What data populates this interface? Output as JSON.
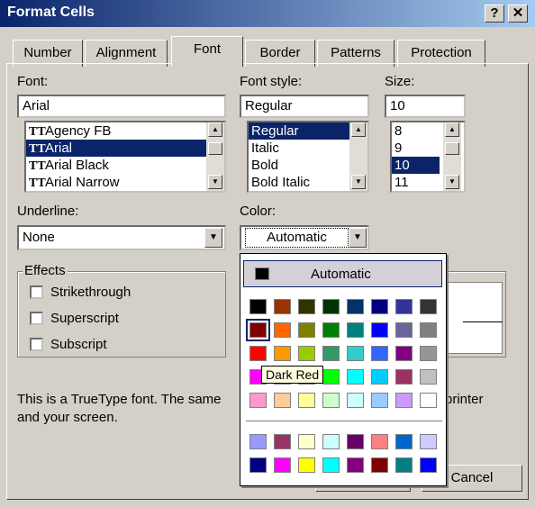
{
  "window": {
    "title": "Format Cells",
    "help_glyph": "?",
    "close_glyph": "✕"
  },
  "tabs": [
    {
      "label": "Number"
    },
    {
      "label": "Alignment"
    },
    {
      "label": "Font",
      "active": true
    },
    {
      "label": "Border"
    },
    {
      "label": "Patterns"
    },
    {
      "label": "Protection"
    }
  ],
  "font": {
    "label": "Font:",
    "value": "Arial",
    "items": [
      {
        "label": "Agency FB"
      },
      {
        "label": "Arial",
        "selected": true
      },
      {
        "label": "Arial Black"
      },
      {
        "label": "Arial Narrow"
      }
    ],
    "type_icon": "TT"
  },
  "font_style": {
    "label": "Font style:",
    "value": "Regular",
    "items": [
      {
        "label": "Regular",
        "selected": true
      },
      {
        "label": "Italic"
      },
      {
        "label": "Bold"
      },
      {
        "label": "Bold Italic"
      }
    ]
  },
  "size": {
    "label": "Size:",
    "value": "10",
    "items": [
      {
        "label": "8"
      },
      {
        "label": "9"
      },
      {
        "label": "10",
        "selected": true
      },
      {
        "label": "11"
      }
    ]
  },
  "underline": {
    "label": "Underline:",
    "value": "None"
  },
  "color": {
    "label": "Color:",
    "value": "Automatic",
    "popup_automatic": "Automatic",
    "tooltip": "Dark Red",
    "palette": [
      [
        "#000000",
        "#993300",
        "#333300",
        "#003300",
        "#003366",
        "#000080",
        "#333399",
        "#333333"
      ],
      [
        "#800000",
        "#ff6600",
        "#808000",
        "#008000",
        "#008080",
        "#0000ff",
        "#666699",
        "#808080"
      ],
      [
        "#ff0000",
        "#ff9900",
        "#99cc00",
        "#339966",
        "#33cccc",
        "#3366ff",
        "#800080",
        "#969696"
      ],
      [
        "#ff00ff",
        "#ffcc00",
        "#ffff00",
        "#00ff00",
        "#00ffff",
        "#00ccff",
        "#993366",
        "#c0c0c0"
      ],
      [
        "#ff99cc",
        "#ffcc99",
        "#ffff99",
        "#ccffcc",
        "#ccffff",
        "#99ccff",
        "#cc99ff",
        "#ffffff"
      ]
    ],
    "chart_palette": [
      [
        "#9999ff",
        "#993366",
        "#ffffcc",
        "#ccffff",
        "#660066",
        "#ff8080",
        "#0066cc",
        "#ccccff"
      ],
      [
        "#000080",
        "#ff00ff",
        "#ffff00",
        "#00ffff",
        "#800080",
        "#800000",
        "#008080",
        "#0000ff"
      ]
    ]
  },
  "effects": {
    "label": "Effects",
    "items": [
      {
        "label": "Strikethrough"
      },
      {
        "label": "Superscript"
      },
      {
        "label": "Subscript"
      }
    ]
  },
  "info_text": "This is a TrueType font.  The same",
  "info_text_tail": "printer",
  "info_text_line2": "and your screen.",
  "buttons": {
    "cancel": "Cancel"
  },
  "icons": {
    "scroll_up": "▲",
    "scroll_down": "▼",
    "dropdown": "▼"
  }
}
